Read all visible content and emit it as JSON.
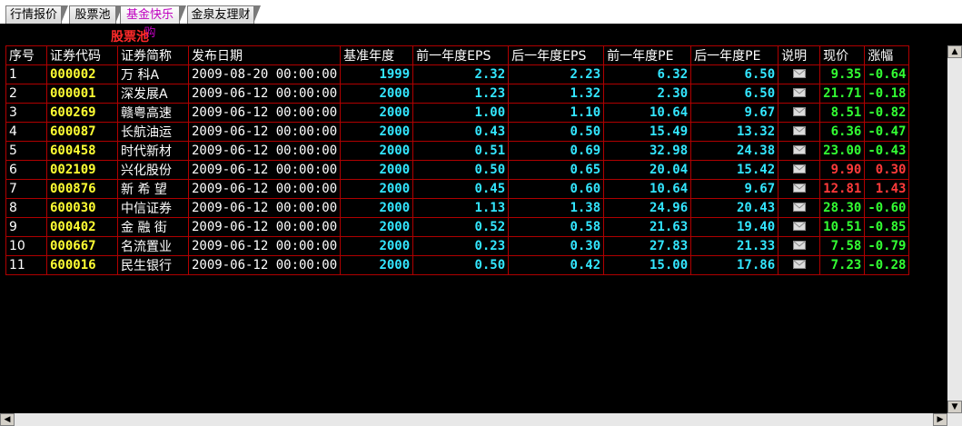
{
  "tabs": [
    {
      "label": "行情报价",
      "active": false
    },
    {
      "label": "股票池",
      "active": false
    },
    {
      "label": "基金快乐购",
      "active": true
    },
    {
      "label": "金泉友理财",
      "active": false
    }
  ],
  "pool_title": "股票池",
  "columns": [
    "序号",
    "证券代码",
    "证券简称",
    "发布日期",
    "基准年度",
    "前一年度EPS",
    "后一年度EPS",
    "前一年度PE",
    "后一年度PE",
    "说明",
    "现价",
    "涨幅"
  ],
  "rows": [
    {
      "idx": "1",
      "code": "000002",
      "name": "万 科A",
      "date": "2009-08-20 00:00:00",
      "year": "1999",
      "eps_prev": "2.32",
      "eps_next": "2.23",
      "pe_prev": "6.32",
      "pe_next": "6.50",
      "price": "9.35",
      "change": "-0.64",
      "dir": "down"
    },
    {
      "idx": "2",
      "code": "000001",
      "name": "深发展A",
      "date": "2009-06-12 00:00:00",
      "year": "2000",
      "eps_prev": "1.23",
      "eps_next": "1.32",
      "pe_prev": "2.30",
      "pe_next": "6.50",
      "price": "21.71",
      "change": "-0.18",
      "dir": "down"
    },
    {
      "idx": "3",
      "code": "600269",
      "name": "赣粤高速",
      "date": "2009-06-12 00:00:00",
      "year": "2000",
      "eps_prev": "1.00",
      "eps_next": "1.10",
      "pe_prev": "10.64",
      "pe_next": "9.67",
      "price": "8.51",
      "change": "-0.82",
      "dir": "down"
    },
    {
      "idx": "4",
      "code": "600087",
      "name": "长航油运",
      "date": "2009-06-12 00:00:00",
      "year": "2000",
      "eps_prev": "0.43",
      "eps_next": "0.50",
      "pe_prev": "15.49",
      "pe_next": "13.32",
      "price": "6.36",
      "change": "-0.47",
      "dir": "down"
    },
    {
      "idx": "5",
      "code": "600458",
      "name": "时代新材",
      "date": "2009-06-12 00:00:00",
      "year": "2000",
      "eps_prev": "0.51",
      "eps_next": "0.69",
      "pe_prev": "32.98",
      "pe_next": "24.38",
      "price": "23.00",
      "change": "-0.43",
      "dir": "down"
    },
    {
      "idx": "6",
      "code": "002109",
      "name": "兴化股份",
      "date": "2009-06-12 00:00:00",
      "year": "2000",
      "eps_prev": "0.50",
      "eps_next": "0.65",
      "pe_prev": "20.04",
      "pe_next": "15.42",
      "price": "9.90",
      "change": "0.30",
      "dir": "up"
    },
    {
      "idx": "7",
      "code": "000876",
      "name": "新 希 望",
      "date": "2009-06-12 00:00:00",
      "year": "2000",
      "eps_prev": "0.45",
      "eps_next": "0.60",
      "pe_prev": "10.64",
      "pe_next": "9.67",
      "price": "12.81",
      "change": "1.43",
      "dir": "up"
    },
    {
      "idx": "8",
      "code": "600030",
      "name": "中信证券",
      "date": "2009-06-12 00:00:00",
      "year": "2000",
      "eps_prev": "1.13",
      "eps_next": "1.38",
      "pe_prev": "24.96",
      "pe_next": "20.43",
      "price": "28.30",
      "change": "-0.60",
      "dir": "down"
    },
    {
      "idx": "9",
      "code": "000402",
      "name": "金 融 街",
      "date": "2009-06-12 00:00:00",
      "year": "2000",
      "eps_prev": "0.52",
      "eps_next": "0.58",
      "pe_prev": "21.63",
      "pe_next": "19.40",
      "price": "10.51",
      "change": "-0.85",
      "dir": "down"
    },
    {
      "idx": "10",
      "code": "000667",
      "name": "名流置业",
      "date": "2009-06-12 00:00:00",
      "year": "2000",
      "eps_prev": "0.23",
      "eps_next": "0.30",
      "pe_prev": "27.83",
      "pe_next": "21.33",
      "price": "7.58",
      "change": "-0.79",
      "dir": "down"
    },
    {
      "idx": "11",
      "code": "600016",
      "name": "民生银行",
      "date": "2009-06-12 00:00:00",
      "year": "2000",
      "eps_prev": "0.50",
      "eps_next": "0.42",
      "pe_prev": "15.00",
      "pe_next": "17.86",
      "price": "7.23",
      "change": "-0.28",
      "dir": "down"
    }
  ],
  "icons": {
    "note": "envelope-icon",
    "scroll_up": "arrow-up-icon",
    "scroll_down": "arrow-down-icon",
    "scroll_left": "arrow-left-icon",
    "scroll_right": "arrow-right-icon"
  },
  "colors": {
    "background": "#000000",
    "grid_border": "#b00000",
    "code": "#ffff33",
    "numeric": "#33e6ff",
    "up": "#ff3b3b",
    "down": "#33ff33",
    "title": "#ff2a2a",
    "active_tab": "#c000c0"
  }
}
